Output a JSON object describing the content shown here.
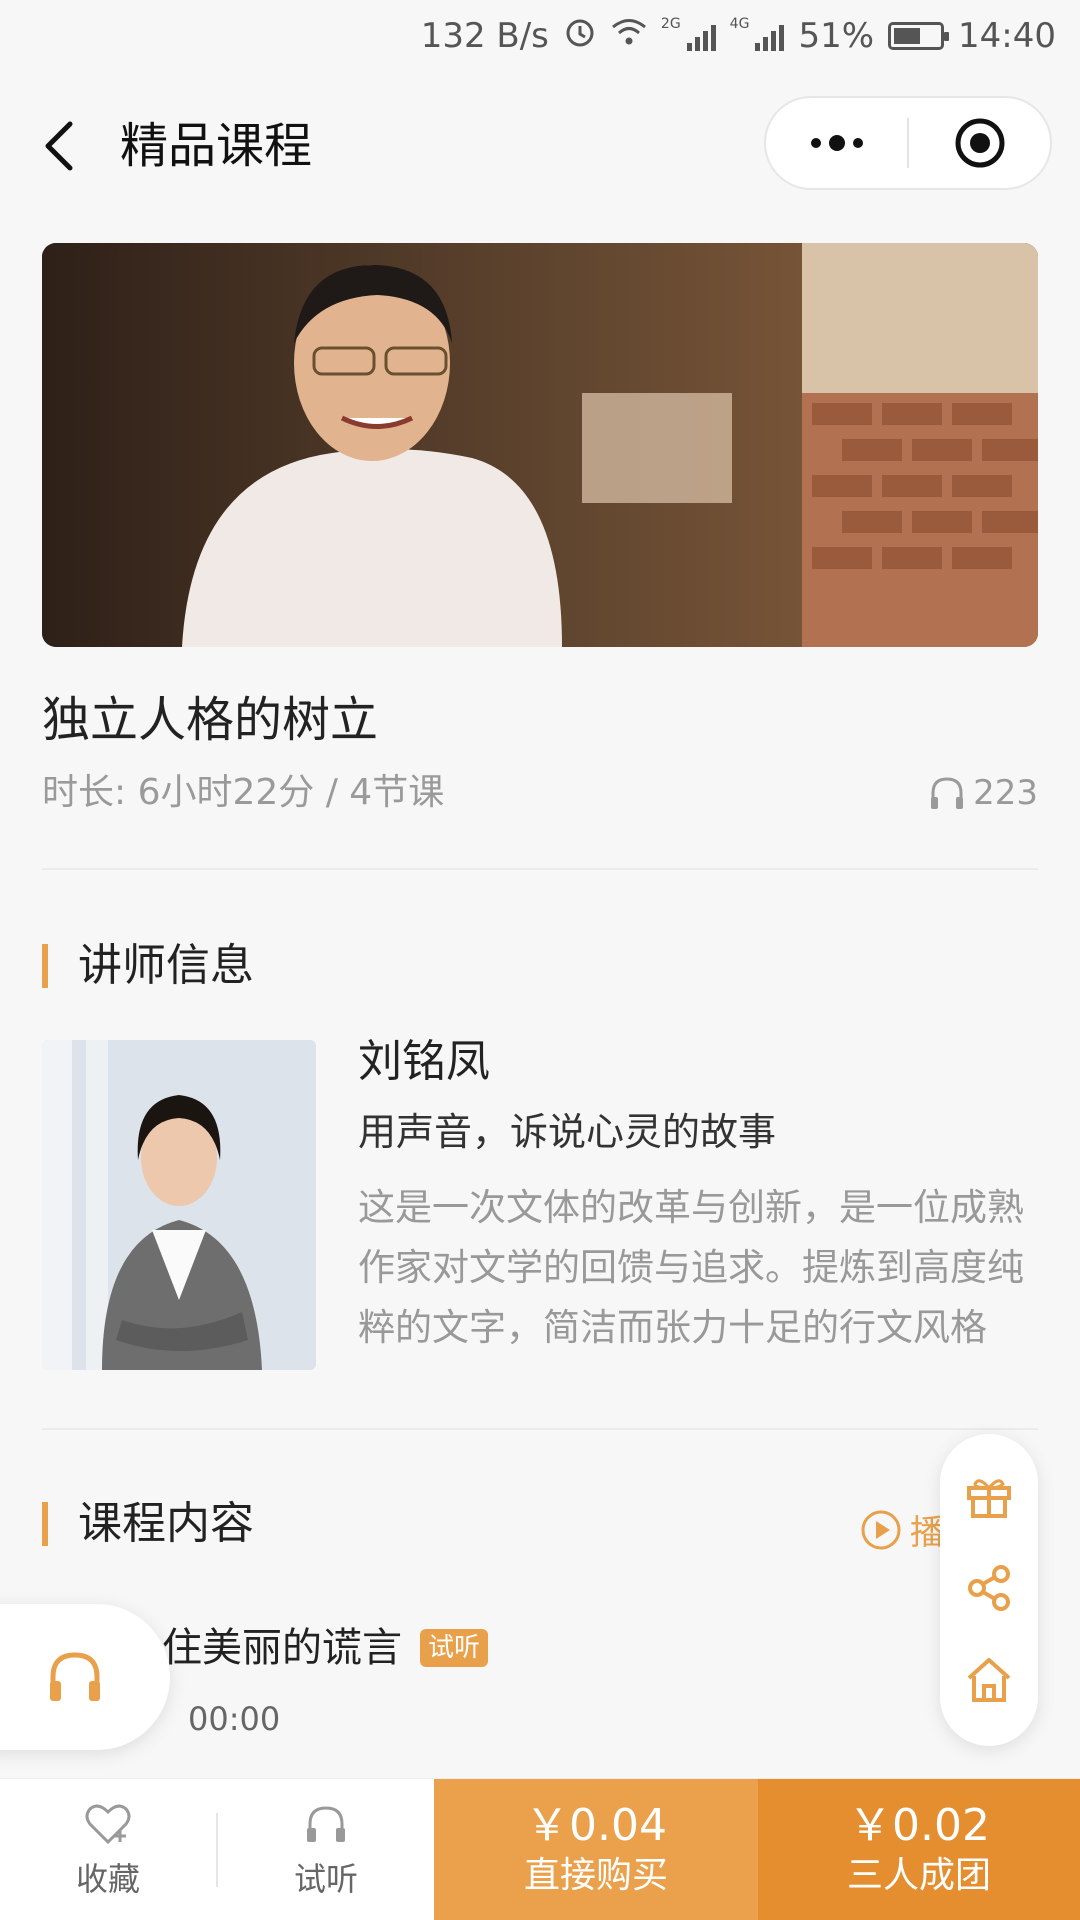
{
  "status_bar": {
    "speed": "132 B/s",
    "net_2g": "2G",
    "net_4g": "4G",
    "battery": "51%",
    "time": "14:40"
  },
  "nav": {
    "title": "精品课程"
  },
  "course": {
    "title": "独立人格的树立",
    "meta": "时长: 6小时22分 / 4节课",
    "listen_count": "223"
  },
  "teacher_section": {
    "heading": "讲师信息",
    "name": "刘铭凤",
    "slogan": "用声音，诉说心灵的故事",
    "description": "这是一次文体的改革与创新，是一位成熟作家对文学的回馈与追求。提炼到高度纯粹的文字，简洁而张力十足的行文风格"
  },
  "content_section": {
    "heading": "课程内容",
    "play_all": "播",
    "lessons": [
      {
        "title": "住美丽的谎言",
        "badge": "试听",
        "time": "00:00"
      }
    ]
  },
  "bottom_bar": {
    "favorite": "收藏",
    "trial": "试听",
    "direct_price": "￥0.04",
    "direct_label": "直接购买",
    "group_price": "￥0.02",
    "group_label": "三人成团"
  },
  "colors": {
    "accent": "#e8a04a",
    "accent_dark": "#e58e2f"
  }
}
